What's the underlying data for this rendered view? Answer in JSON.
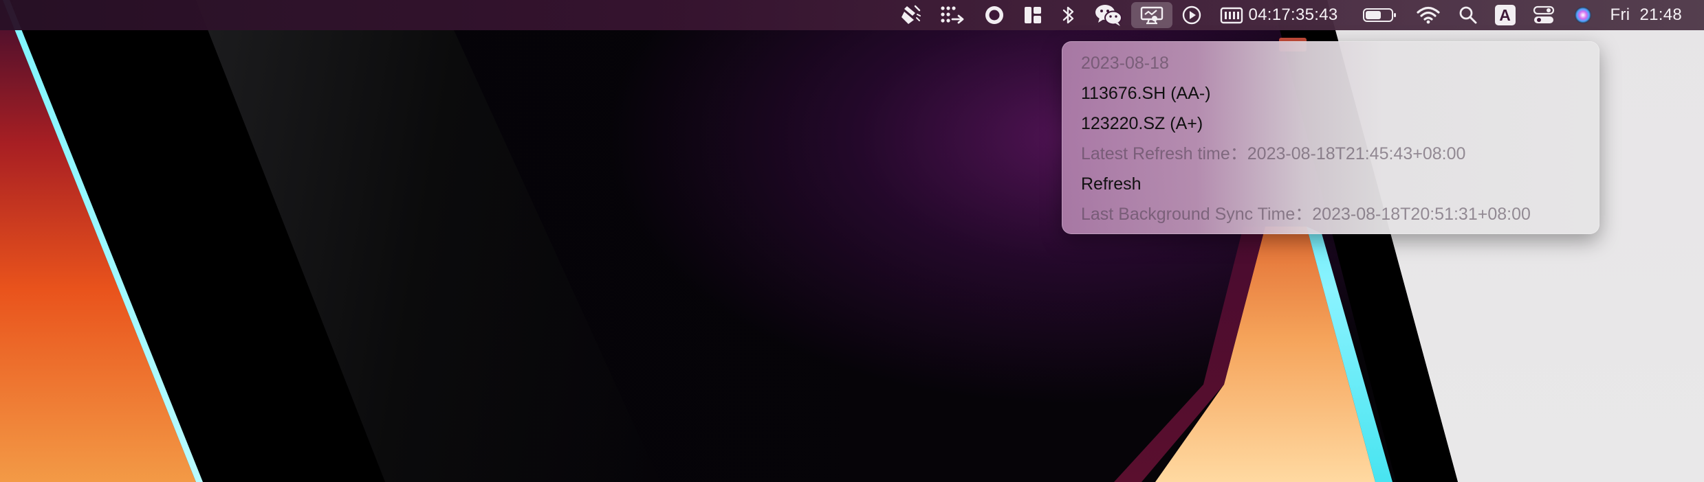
{
  "menubar": {
    "items": [
      {
        "icon": "clean-broom-icon"
      },
      {
        "icon": "dots-arrow-icon"
      },
      {
        "icon": "record-circle-icon"
      },
      {
        "icon": "window-layout-icon"
      },
      {
        "icon": "bluetooth-icon"
      },
      {
        "icon": "wechat-icon"
      },
      {
        "icon": "bond-monitor-icon",
        "active": true
      },
      {
        "icon": "play-circle-icon"
      }
    ],
    "timer_text": "04:17:35:43",
    "clock_day": "Fri",
    "clock_time": "21:48",
    "input_source": "A"
  },
  "dropdown": {
    "date": "2023-08-18",
    "items": [
      {
        "label": "113676.SH (AA-)"
      },
      {
        "label": "123220.SZ (A+)"
      }
    ],
    "latest_refresh": "Latest Refresh time：2023-08-18T21:45:43+08:00",
    "refresh_label": "Refresh",
    "last_sync": "Last Background Sync Time：2023-08-18T20:51:31+08:00"
  },
  "colors": {
    "menu_text": "#f6f2f6",
    "dropdown_disabled": "#7a6a7c",
    "dropdown_enabled": "#101010"
  }
}
